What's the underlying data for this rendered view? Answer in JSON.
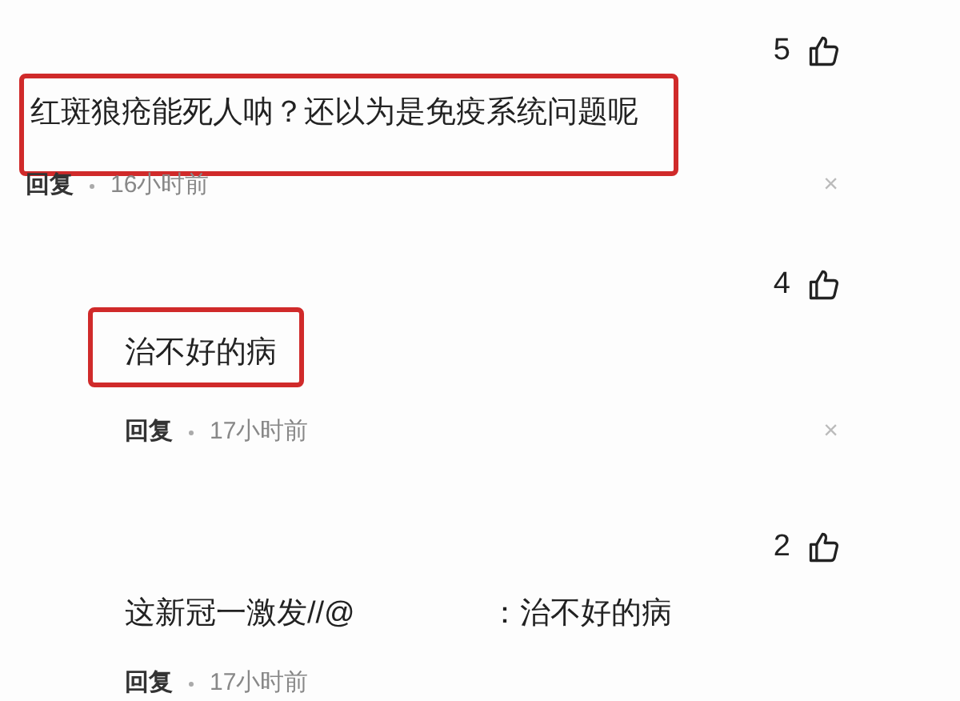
{
  "comments": [
    {
      "likes": "5",
      "highlighted": true,
      "indented": false,
      "text_parts": [
        "红斑狼疮能死人呐？还以为是免疫系统问题呢"
      ],
      "reply": "回复",
      "time": "16小时前",
      "dismiss": "×"
    },
    {
      "likes": "4",
      "highlighted": true,
      "indented": true,
      "text_parts": [
        "治不好的病"
      ],
      "reply": "回复",
      "time": "17小时前",
      "dismiss": "×"
    },
    {
      "likes": "2",
      "highlighted": false,
      "indented": true,
      "text_parts": [
        "这新冠一激发//@",
        "：治不好的病"
      ],
      "reply": "回复",
      "time": "17小时前"
    }
  ]
}
